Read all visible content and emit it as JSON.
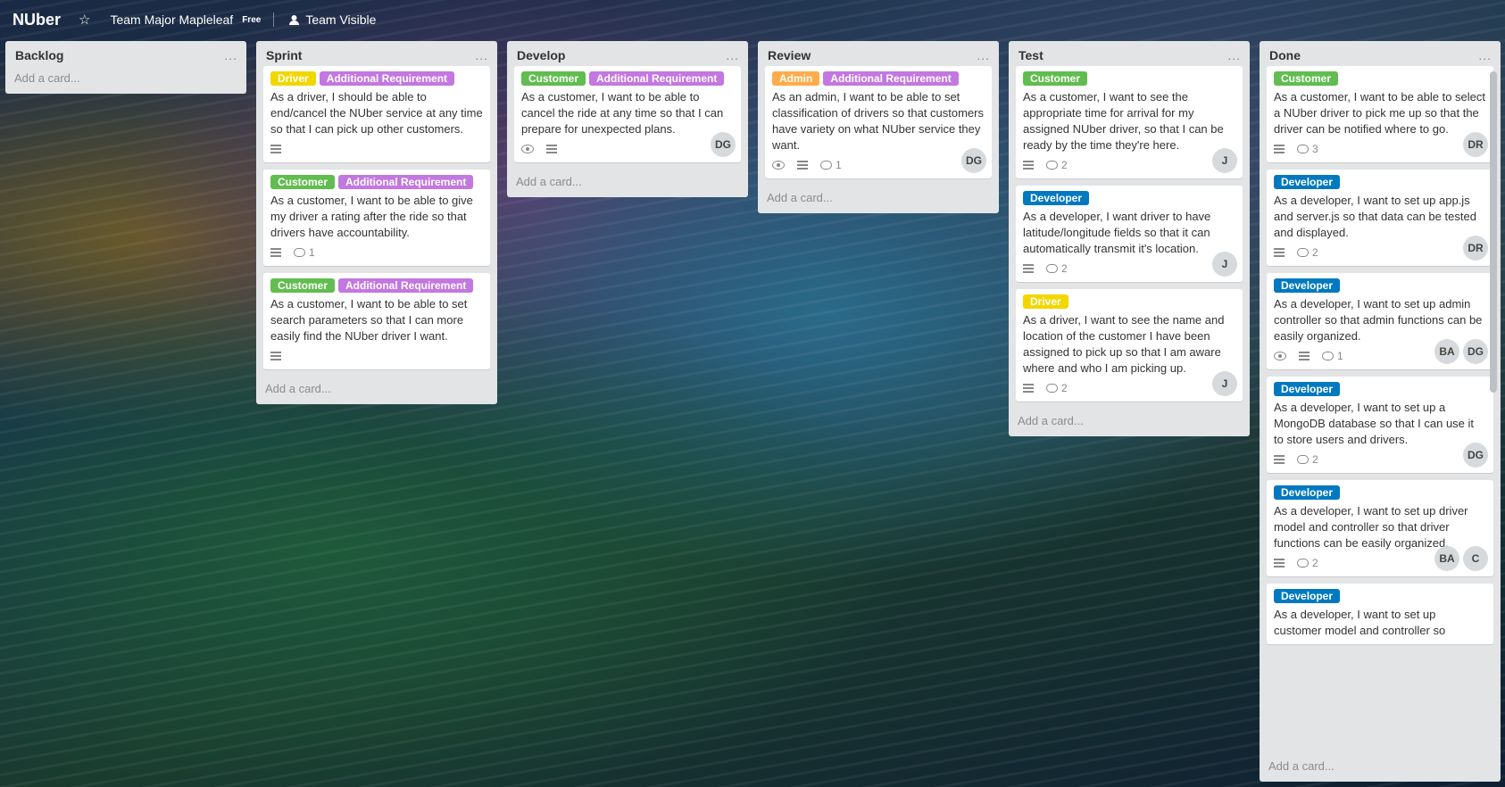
{
  "header": {
    "board_title": "NUber",
    "star_icon": "star-icon",
    "team_name": "Team Major Mapleleaf",
    "team_plan": "Free",
    "visibility": "Team Visible",
    "visibility_icon": "team-icon"
  },
  "colors": {
    "list_bg": "#e2e4e6",
    "label_green": "#61bd4f",
    "label_purple": "#c377e0",
    "label_yellow": "#f2d600",
    "label_orange": "#ffab4a",
    "label_blue": "#0079bf"
  },
  "lists": [
    {
      "title": "Backlog",
      "menu": "...",
      "add_card": "Add a card...",
      "cards": []
    },
    {
      "title": "Sprint",
      "menu": "...",
      "add_card": "Add a card...",
      "cards": [
        {
          "labels": [
            {
              "text": "Driver",
              "color": "#f2d600"
            },
            {
              "text": "Additional Requirement",
              "color": "#c377e0"
            }
          ],
          "text": "As a driver, I should be able to end/cancel the NUber service at any time so that I can pick up other customers.",
          "watch": false,
          "desc": true,
          "comments": null,
          "members": []
        },
        {
          "labels": [
            {
              "text": "Customer",
              "color": "#61bd4f"
            },
            {
              "text": "Additional Requirement",
              "color": "#c377e0"
            }
          ],
          "text": "As a customer, I want to be able to give my driver a rating after the ride so that drivers have accountability.",
          "watch": false,
          "desc": true,
          "comments": "1",
          "members": []
        },
        {
          "labels": [
            {
              "text": "Customer",
              "color": "#61bd4f"
            },
            {
              "text": "Additional Requirement",
              "color": "#c377e0"
            }
          ],
          "text": "As a customer, I want to be able to set search parameters so that I can more easily find the NUber driver I want.",
          "watch": false,
          "desc": true,
          "comments": null,
          "members": []
        }
      ]
    },
    {
      "title": "Develop",
      "menu": "...",
      "add_card": "Add a card...",
      "cards": [
        {
          "labels": [
            {
              "text": "Customer",
              "color": "#61bd4f"
            },
            {
              "text": "Additional Requirement",
              "color": "#c377e0"
            }
          ],
          "text": "As a customer, I want to be able to cancel the ride at any time so that I can prepare for unexpected plans.",
          "watch": true,
          "desc": true,
          "comments": null,
          "members": [
            "DG"
          ]
        }
      ]
    },
    {
      "title": "Review",
      "menu": "...",
      "add_card": "Add a card...",
      "cards": [
        {
          "labels": [
            {
              "text": "Admin",
              "color": "#ffab4a"
            },
            {
              "text": "Additional Requirement",
              "color": "#c377e0"
            }
          ],
          "text": "As an admin, I want to be able to set classification of drivers so that customers have variety on what NUber service they want.",
          "watch": true,
          "desc": true,
          "comments": "1",
          "members": [
            "DG"
          ]
        }
      ]
    },
    {
      "title": "Test",
      "menu": "...",
      "add_card": "Add a card...",
      "cards": [
        {
          "labels": [
            {
              "text": "Customer",
              "color": "#61bd4f"
            }
          ],
          "text": "As a customer, I want to see the appropriate time for arrival for my assigned NUber driver, so that I can be ready by the time they're here.",
          "watch": false,
          "desc": true,
          "comments": "2",
          "members": [
            "J"
          ]
        },
        {
          "labels": [
            {
              "text": "Developer",
              "color": "#0079bf"
            }
          ],
          "text": "As a developer, I want driver to have latitude/longitude fields so that it can automatically transmit it's location.",
          "watch": false,
          "desc": true,
          "comments": "2",
          "members": [
            "J"
          ]
        },
        {
          "labels": [
            {
              "text": "Driver",
              "color": "#f2d600"
            }
          ],
          "text": "As a driver, I want to see the name and location of the customer I have been assigned to pick up so that I am aware where and who I am picking up.",
          "watch": false,
          "desc": true,
          "comments": "2",
          "members": [
            "J"
          ]
        }
      ]
    },
    {
      "title": "Done",
      "menu": "...",
      "add_card": "Add a card...",
      "cards": [
        {
          "labels": [
            {
              "text": "Customer",
              "color": "#61bd4f"
            }
          ],
          "text": "As a customer, I want to be able to select a NUber driver to pick me up so that the driver can be notified where to go.",
          "watch": false,
          "desc": true,
          "comments": "3",
          "members": [
            "DR"
          ]
        },
        {
          "labels": [
            {
              "text": "Developer",
              "color": "#0079bf"
            }
          ],
          "text": "As a developer, I want to set up app.js and server.js so that data can be tested and displayed.",
          "watch": false,
          "desc": true,
          "comments": "2",
          "members": [
            "DR"
          ]
        },
        {
          "labels": [
            {
              "text": "Developer",
              "color": "#0079bf"
            }
          ],
          "text": "As a developer, I want to set up admin controller so that admin functions can be easily organized.",
          "watch": true,
          "desc": true,
          "comments": "1",
          "members": [
            "BA",
            "DG"
          ]
        },
        {
          "labels": [
            {
              "text": "Developer",
              "color": "#0079bf"
            }
          ],
          "text": "As a developer, I want to set up a MongoDB database so that I can use it to store users and drivers.",
          "watch": false,
          "desc": true,
          "comments": "2",
          "members": [
            "DG"
          ]
        },
        {
          "labels": [
            {
              "text": "Developer",
              "color": "#0079bf"
            }
          ],
          "text": "As a developer, I want to set up driver model and controller so that driver functions can be easily organized.",
          "watch": false,
          "desc": true,
          "comments": "2",
          "members": [
            "BA",
            "C"
          ]
        },
        {
          "labels": [
            {
              "text": "Developer",
              "color": "#0079bf"
            }
          ],
          "text": "As a developer, I want to set up customer model and controller so",
          "watch": false,
          "desc": false,
          "comments": null,
          "members": []
        }
      ]
    }
  ]
}
